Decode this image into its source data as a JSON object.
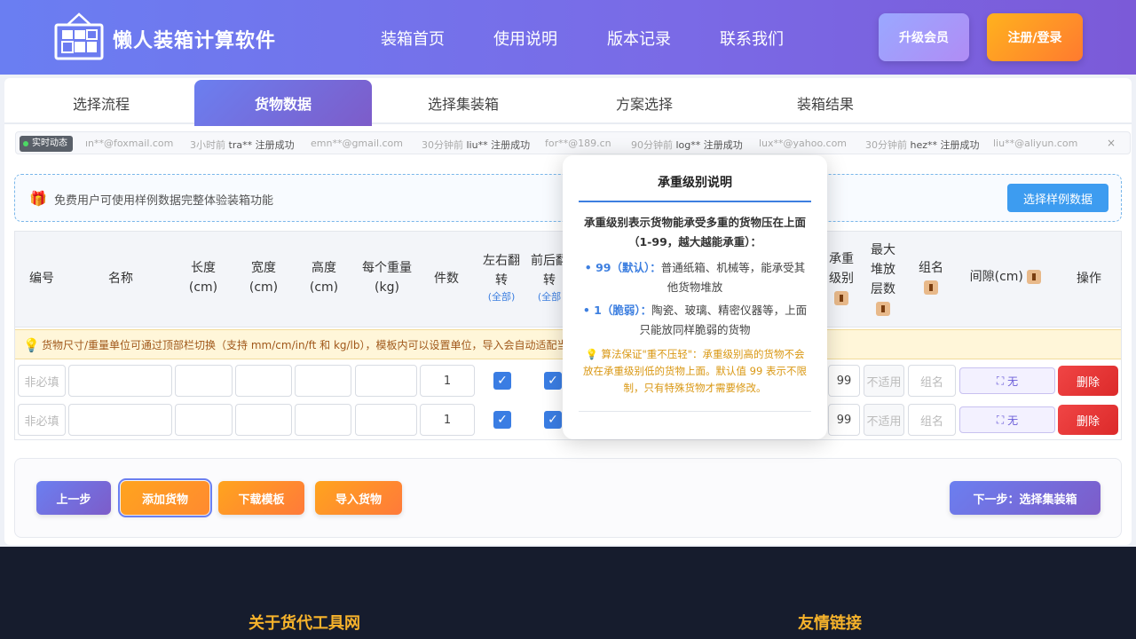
{
  "header": {
    "brand": "懒人装箱计算软件",
    "nav": [
      "装箱首页",
      "使用说明",
      "版本记录",
      "联系我们"
    ],
    "vip_btn": "升级会员",
    "login_btn": "注册/登录"
  },
  "tabs": [
    "选择流程",
    "货物数据",
    "选择集装箱",
    "方案选择",
    "装箱结果"
  ],
  "active_tab": "货物数据",
  "ticker": {
    "badge": "实时动态",
    "items": [
      {
        "pre": "",
        "name": "",
        "text": "ın**@foxmail.com"
      },
      {
        "pre": "3小时前",
        "name": "tra**",
        "text": "注册成功"
      },
      {
        "pre": "",
        "name": "",
        "text": "emn**@gmail.com"
      },
      {
        "pre": "30分钟前",
        "name": "liu**",
        "text": "注册成功"
      },
      {
        "pre": "",
        "name": "",
        "text": "for**@189.cn"
      },
      {
        "pre": "90分钟前",
        "name": "log**",
        "text": "注册成功"
      },
      {
        "pre": "",
        "name": "",
        "text": "lux**@yahoo.com"
      },
      {
        "pre": "30分钟前",
        "name": "hez**",
        "text": "注册成功"
      },
      {
        "pre": "",
        "name": "",
        "text": "liu**@aliyun.com"
      }
    ],
    "close": "×"
  },
  "notice": {
    "text": "免费用户可使用样例数据完整体验装箱功能",
    "button": "选择样例数据"
  },
  "table": {
    "headers": {
      "id": "编号",
      "name": "名称",
      "length": "长度",
      "length_unit": "(cm)",
      "width": "宽度",
      "width_unit": "(cm)",
      "height": "高度",
      "height_unit": "(cm)",
      "weight": "每个重量",
      "weight_unit": "(kg)",
      "count": "件数",
      "flip_lr_1": "左右翻",
      "flip_lr_2": "转",
      "flip_lr_all": "(全部)",
      "flip_fb_1": "前后翻",
      "flip_fb_2": "转",
      "flip_fb_all": "(全部",
      "bear_1": "承重",
      "bear_2": "级别",
      "max_1": "最大",
      "max_2": "堆放",
      "max_3": "层数",
      "group": "组名",
      "gap": "间隙(cm)",
      "action": "操作"
    },
    "tip": "货物尺寸/重量单位可通过顶部栏切换（支持 mm/cm/in/ft 和 kg/lb），模板内可以设置单位，导入会自动适配当前",
    "rows": [
      {
        "id_ph": "非必填",
        "count": "1",
        "bear": "99",
        "max_ph": "不适用",
        "group_ph": "组名",
        "gap": "无",
        "del": "删除"
      },
      {
        "id_ph": "非必填",
        "count": "1",
        "bear": "99",
        "max_ph": "不适用",
        "group_ph": "组名",
        "gap": "无",
        "del": "删除"
      }
    ]
  },
  "actions": {
    "prev": "上一步",
    "add": "添加货物",
    "download": "下载模板",
    "import": "导入货物",
    "next": "下一步：选择集装箱"
  },
  "footer": {
    "about": "关于货代工具网",
    "links": "友情链接"
  },
  "popup": {
    "title": "承重级别说明",
    "intro": "承重级别表示货物能承受多重的货物压在上面（1-99，越大越能承重）：",
    "item1_label": "• 99（默认）：",
    "item1_text": "普通纸箱、机械等，能承受其他货物堆放",
    "item2_label": "• 1（脆弱）：",
    "item2_text": "陶瓷、玻璃、精密仪器等，上面只能放同样脆弱的货物",
    "warn": "💡 算法保证\"重不压轻\"：承重级别高的货物不会放在承重级别低的货物上面。默认值 99 表示不限制，只有特殊货物才需要修改。"
  }
}
